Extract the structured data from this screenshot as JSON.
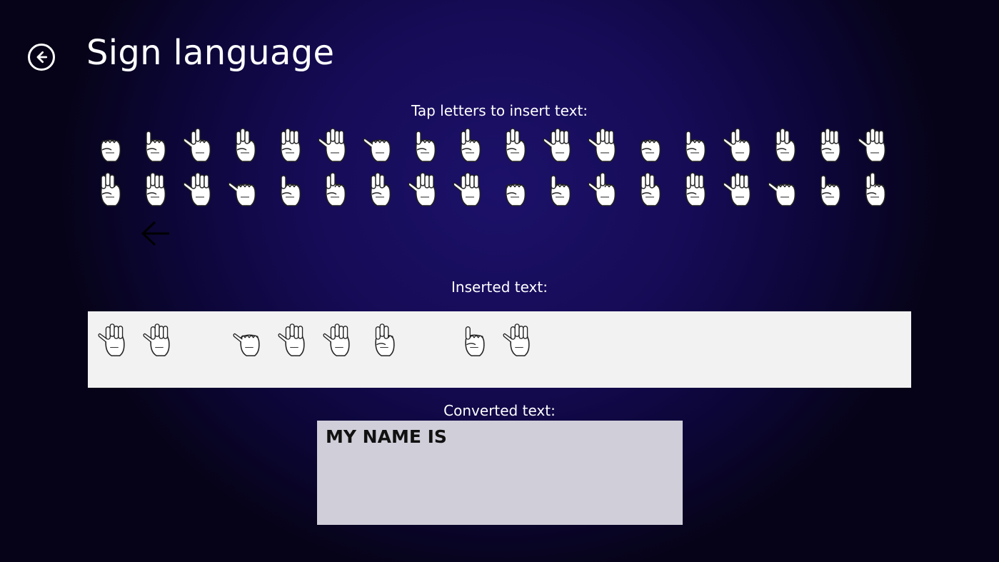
{
  "header": {
    "title": "Sign language",
    "back_icon": "back-arrow-circle-icon"
  },
  "keyboard": {
    "label": "Tap letters to insert text:",
    "row1": [
      "A",
      "B",
      "C",
      "D",
      "E",
      "F",
      "G",
      "H",
      "I",
      "J",
      "K",
      "L",
      "M",
      "N",
      "O",
      "P",
      "Q",
      "R"
    ],
    "row2": [
      "S",
      "T",
      "U",
      "V",
      "W",
      "X",
      "Y",
      "Z",
      "1",
      "2",
      "3",
      "4",
      "5",
      "6",
      "7",
      "8",
      "9",
      "10"
    ],
    "key_icon": "hand-sign-icon",
    "backspace_icon": "backspace-arrow-icon"
  },
  "inserted": {
    "label": "Inserted text:",
    "signs": [
      "M",
      "Y",
      " ",
      "N",
      "A",
      "M",
      "E",
      " ",
      "I",
      "S"
    ]
  },
  "converted": {
    "label": "Converted text:",
    "value": "MY NAME IS"
  },
  "colors": {
    "background": "#150b55",
    "inserted_box": "#f2f2f2",
    "converted_box": "#d0ced9",
    "text": "#ffffff"
  }
}
